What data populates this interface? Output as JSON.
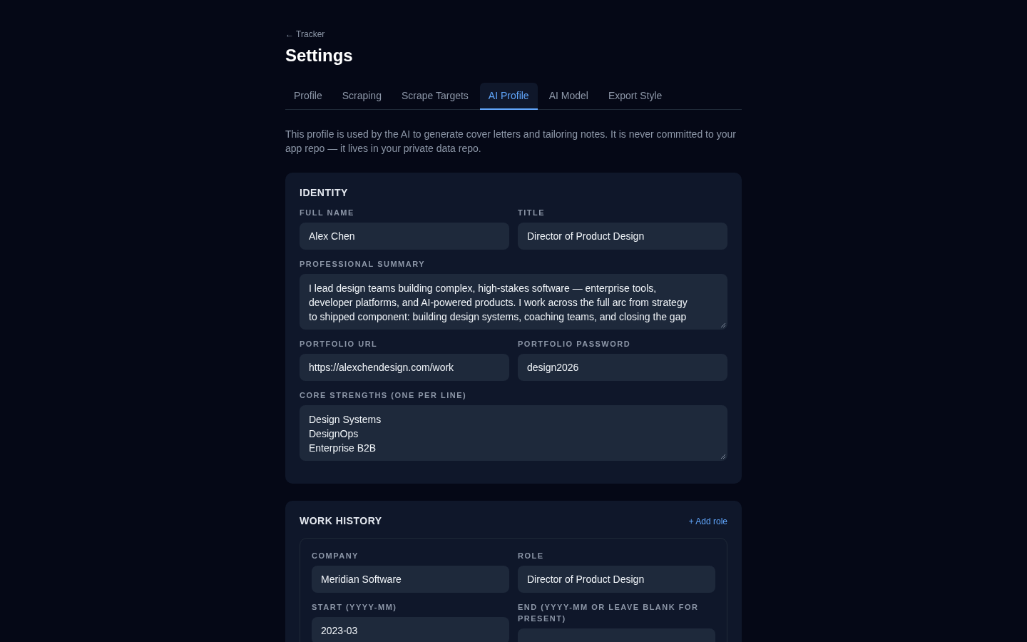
{
  "back_link": "← Tracker",
  "title": "Settings",
  "tabs": [
    {
      "label": "Profile",
      "selected": false
    },
    {
      "label": "Scraping",
      "selected": false
    },
    {
      "label": "Scrape Targets",
      "selected": false
    },
    {
      "label": "AI Profile",
      "selected": true
    },
    {
      "label": "AI Model",
      "selected": false
    },
    {
      "label": "Export Style",
      "selected": false
    }
  ],
  "description": "This profile is used by the AI to generate cover letters and tailoring notes. It is never committed to your app repo — it lives in your private data repo.",
  "identity": {
    "heading": "IDENTITY",
    "full_name": {
      "label": "FULL NAME",
      "value": "Alex Chen"
    },
    "title": {
      "label": "TITLE",
      "value": "Director of Product Design"
    },
    "summary": {
      "label": "PROFESSIONAL SUMMARY",
      "lines": [
        "I lead design teams building complex, high-stakes software — enterprise tools,",
        "developer platforms, and AI-powered products. I work across the full arc from strategy",
        "to shipped component: building design systems, coaching teams, and closing the gap"
      ]
    },
    "portfolio_url": {
      "label": "PORTFOLIO URL",
      "value": "https://alexchendesign.com/work"
    },
    "portfolio_password": {
      "label": "PORTFOLIO PASSWORD",
      "value": "design2026"
    },
    "strengths": {
      "label": "CORE STRENGTHS (ONE PER LINE)",
      "lines": [
        "Design Systems",
        "DesignOps",
        "Enterprise B2B"
      ]
    }
  },
  "work_history": {
    "heading": "WORK HISTORY",
    "add_button": "+ Add role",
    "roles": [
      {
        "company": {
          "label": "COMPANY",
          "value": "Meridian Software"
        },
        "role": {
          "label": "ROLE",
          "value": "Director of Product Design"
        },
        "start": {
          "label": "START (YYYY-MM)",
          "value": "2023-03"
        },
        "end": {
          "label": "END (YYYY-MM OR LEAVE BLANK FOR PRESENT)"
        }
      }
    ]
  }
}
